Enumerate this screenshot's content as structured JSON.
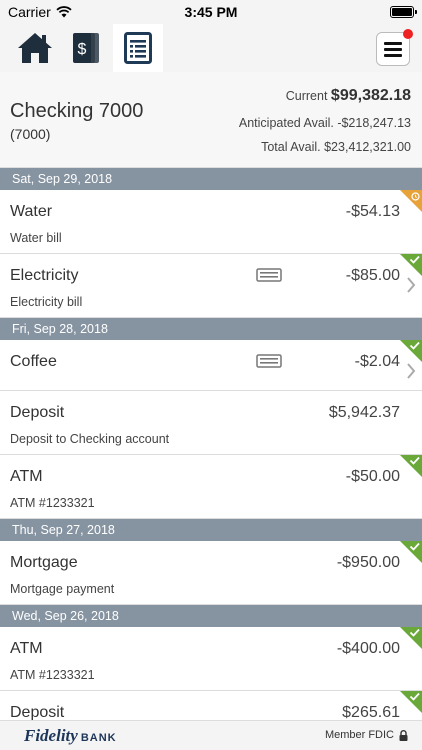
{
  "status": {
    "carrier": "Carrier",
    "time": "3:45 PM"
  },
  "nav": {
    "tabs": [
      {
        "id": "home",
        "icon": "home-icon"
      },
      {
        "id": "money",
        "icon": "dollar-cards-icon"
      },
      {
        "id": "transactions",
        "icon": "register-icon"
      }
    ],
    "menu_icon": "hamburger-icon",
    "notification_color": "#e22222"
  },
  "account": {
    "name": "Checking 7000",
    "number": "(7000)",
    "current_label": "Current",
    "current_value": "$99,382.18",
    "anticipated": "Anticipated Avail. -$218,247.13",
    "total": "Total Avail. $23,412,321.00"
  },
  "groups": [
    {
      "date": "Sat, Sep 29, 2018",
      "items": [
        {
          "name": "Water",
          "desc": "Water bill",
          "amount": "-$54.13",
          "status": "pending"
        },
        {
          "name": "Electricity",
          "desc": "Electricity bill",
          "amount": "-$85.00",
          "status": "cleared",
          "check": true,
          "chevron": true
        }
      ]
    },
    {
      "date": "Fri, Sep 28, 2018",
      "items": [
        {
          "name": "Coffee",
          "desc": "",
          "amount": "-$2.04",
          "status": "cleared",
          "check": true,
          "chevron": true
        },
        {
          "name": "Deposit",
          "desc": "Deposit to Checking account",
          "amount": "$5,942.37",
          "status": "cleared"
        },
        {
          "name": "ATM",
          "desc": "ATM #1233321",
          "amount": "-$50.00",
          "status": "cleared"
        }
      ]
    },
    {
      "date": "Thu, Sep 27, 2018",
      "items": [
        {
          "name": "Mortgage",
          "desc": "Mortgage payment",
          "amount": "-$950.00",
          "status": "cleared"
        }
      ]
    },
    {
      "date": "Wed, Sep 26, 2018",
      "items": [
        {
          "name": "ATM",
          "desc": "ATM #1233321",
          "amount": "-$400.00",
          "status": "cleared"
        },
        {
          "name": "Deposit",
          "desc": "",
          "amount": "$265.61",
          "status": "cleared"
        }
      ]
    }
  ],
  "colors": {
    "cleared": "#6aa83a",
    "pending": "#e8a23a",
    "date_bar": "#8693a1"
  },
  "footer": {
    "logo": "Fidelity",
    "logo_suffix": "BANK",
    "fdic": "Member FDIC"
  }
}
